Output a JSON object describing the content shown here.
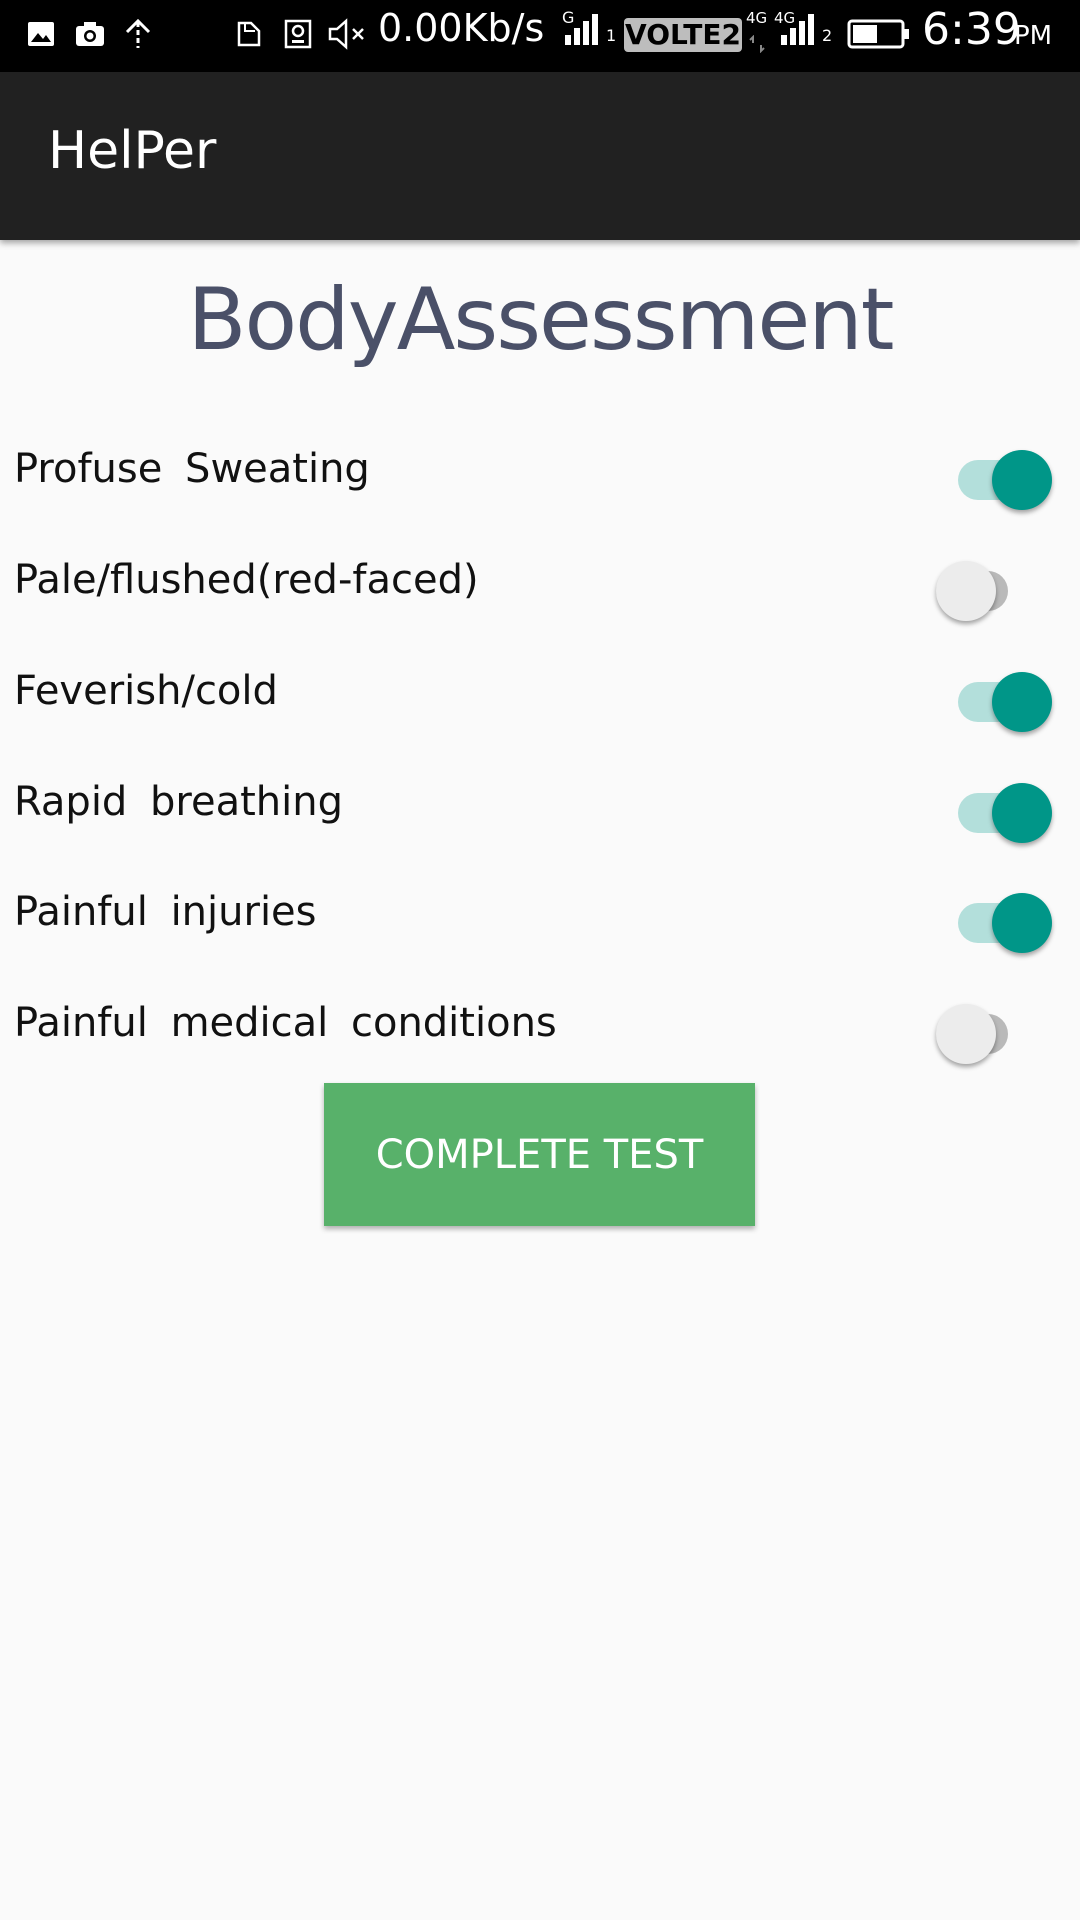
{
  "status_bar": {
    "network_speed": "0.00Kb/s",
    "sim1_label": "G",
    "sim1_index": "1",
    "volte_badge": "VOLTE2",
    "network_type": "4G",
    "network_type_2": "4G",
    "sim2_index": "2",
    "time": "6:39",
    "am_pm": "PM",
    "icons": [
      "image-icon",
      "camera-icon",
      "upload-icon",
      "nfc-icon",
      "sd-card-icon",
      "mute-icon",
      "signal-icon",
      "battery-icon"
    ]
  },
  "app_bar": {
    "title": "HelPer"
  },
  "page": {
    "heading": "BodyAssessment"
  },
  "assessment_items": [
    {
      "label": "Profuse Sweating",
      "checked": true
    },
    {
      "label": "Pale/flushed(red-faced)",
      "checked": false
    },
    {
      "label": "Feverish/cold",
      "checked": true
    },
    {
      "label": "Rapid breathing",
      "checked": true
    },
    {
      "label": "Painful injuries",
      "checked": true
    },
    {
      "label": "Painful medical conditions",
      "checked": false
    }
  ],
  "actions": {
    "complete_label": "COMPLETE TEST"
  },
  "colors": {
    "switch_on": "#009688",
    "switch_on_track": "#b3dfdb",
    "switch_off_thumb": "#ececec",
    "switch_off_track": "#b9b9b9",
    "button": "#58b16a",
    "app_bar": "#212121",
    "heading": "#4a5068"
  }
}
